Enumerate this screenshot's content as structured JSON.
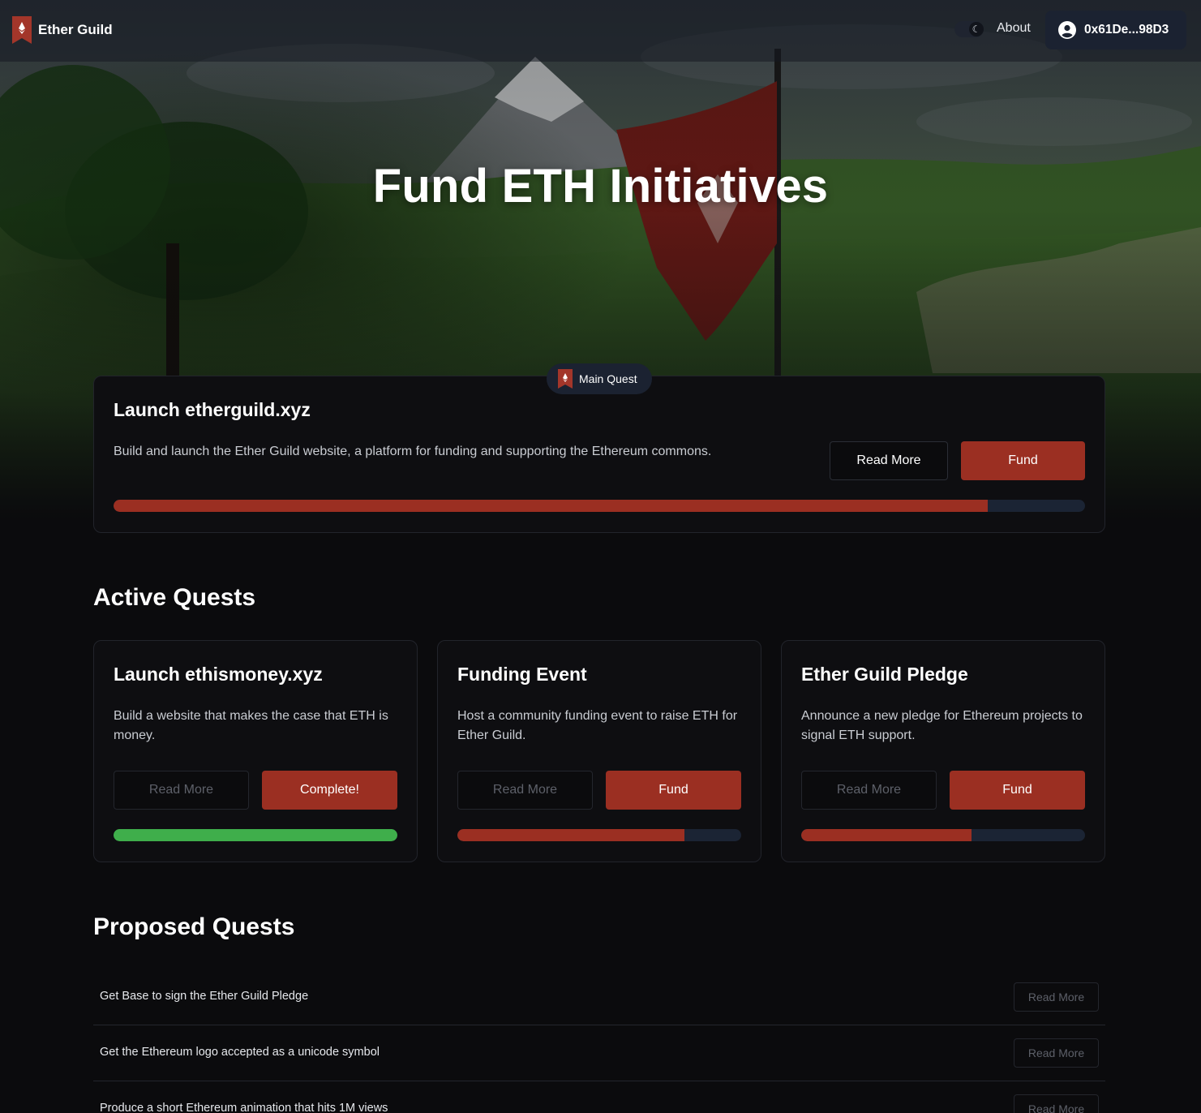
{
  "nav": {
    "brand": "Ether Guild",
    "about_label": "About",
    "wallet_address": "0x61De...98D3",
    "theme_toggle_icon": "moon-icon",
    "wallet_icon": "user-circle-icon"
  },
  "hero": {
    "title": "Fund ETH Initiatives"
  },
  "main_quest": {
    "badge_label": "Main Quest",
    "title": "Launch etherguild.xyz",
    "description": "Build and launch the Ether Guild website, a platform for funding and supporting the Ethereum commons.",
    "read_more_label": "Read More",
    "fund_label": "Fund",
    "progress": 0.9
  },
  "active_quests": {
    "title": "Active Quests",
    "items": [
      {
        "title": "Launch ethismoney.xyz",
        "description": "Build a website that makes the case that ETH is money.",
        "read_more_label": "Read More",
        "action_label": "Complete!",
        "progress": 1.0,
        "complete": true
      },
      {
        "title": "Funding Event",
        "description": "Host a community funding event to raise ETH for Ether Guild.",
        "read_more_label": "Read More",
        "action_label": "Fund",
        "progress": 0.8,
        "complete": false
      },
      {
        "title": "Ether Guild Pledge",
        "description": "Announce a new pledge for Ethereum projects to signal ETH support.",
        "read_more_label": "Read More",
        "action_label": "Fund",
        "progress": 0.6,
        "complete": false
      }
    ]
  },
  "proposed_quests": {
    "title": "Proposed Quests",
    "items": [
      {
        "title": "Get Base to sign the Ether Guild Pledge",
        "read_more_label": "Read More"
      },
      {
        "title": "Get the Ethereum logo accepted as a unicode symbol",
        "read_more_label": "Read More"
      },
      {
        "title": "Produce a short Ethereum animation that hits 1M views",
        "read_more_label": "Read More"
      }
    ]
  },
  "colors": {
    "accent": "#9b2f22",
    "complete": "#3fae4b",
    "track": "#1b2434",
    "background": "#0b0b0d"
  }
}
